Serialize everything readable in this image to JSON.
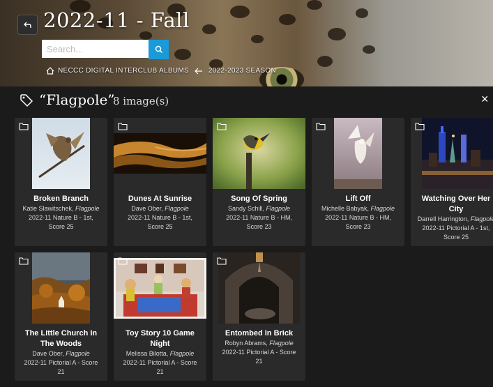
{
  "header": {
    "title": "2022-11 - Fall",
    "search_placeholder": "Search...",
    "breadcrumb": [
      {
        "label": "NECCC DIGITAL INTERCLUB ALBUMS"
      },
      {
        "label": "2022-2023 SEASON"
      }
    ]
  },
  "panel": {
    "title": "“Flagpole”",
    "count": "8 image(s)",
    "close": "×"
  },
  "cards": [
    {
      "title": "Broken Branch",
      "author": "Katie Slawitschek",
      "tag": "Flagpole",
      "line1": "2022-11 Nature B - 1st,",
      "line2": "Score 25"
    },
    {
      "title": "Dunes At Sunrise",
      "author": "Dave Ober",
      "tag": "Flagpole",
      "line1": "2022-11 Nature B - 1st,",
      "line2": "Score 25"
    },
    {
      "title": "Song Of Spring",
      "author": "Sandy Schill",
      "tag": "Flagpole",
      "line1": "2022-11 Nature B - HM,",
      "line2": "Score 23"
    },
    {
      "title": "Lift Off",
      "author": "Michelle Babyak",
      "tag": "Flagpole",
      "line1": "2022-11 Nature B - HM,",
      "line2": "Score 23"
    },
    {
      "title": "Watching Over Her City",
      "author": "Darrell Harrington",
      "tag": "Flagpole",
      "line1": "2022-11 Pictorial A - 1st,",
      "line2": "Score 25"
    },
    {
      "title": "The Little Church In The Woods",
      "author": "Dave Ober",
      "tag": "Flagpole",
      "line1": "2022-11 Pictorial A - Score",
      "line2": "21"
    },
    {
      "title": "Toy Story 10 Game Night",
      "author": "Melissa Bilotta",
      "tag": "Flagpole",
      "line1": "2022-11 Pictorial A - Score",
      "line2": "21"
    },
    {
      "title": "Entombed In Brick",
      "author": "Robyn Abrams",
      "tag": "Flagpole",
      "line1": "2022-11 Pictorial A - Score",
      "line2": "21"
    }
  ],
  "colors": {
    "accent": "#1a9ad6",
    "card_bg": "#2a2a2a",
    "page_bg": "#1b1b1b"
  },
  "icons": [
    "back-arrow-icon",
    "search-icon",
    "home-icon",
    "left-arrow-icon",
    "tag-icon",
    "close-icon",
    "folder-icon"
  ]
}
